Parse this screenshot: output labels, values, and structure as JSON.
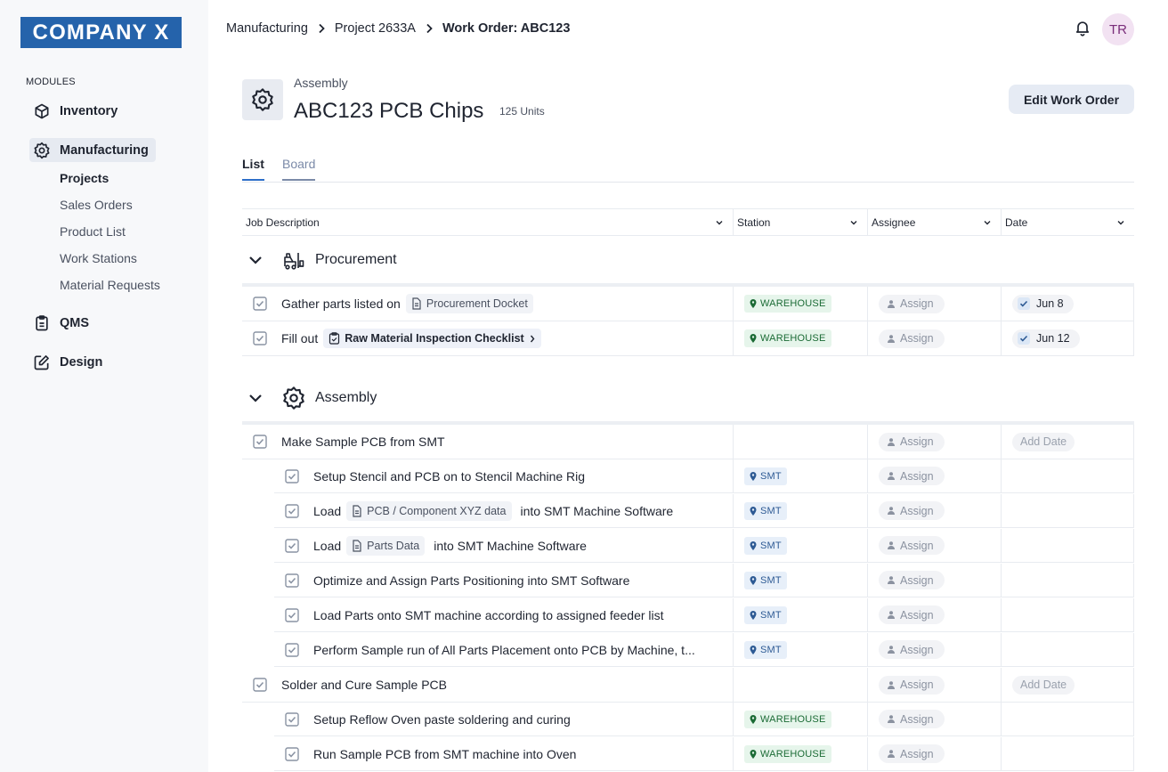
{
  "brand": {
    "logo_text": "COMPANY X",
    "accent": "#2563ab"
  },
  "sidebar": {
    "modules_label": "MODULES",
    "items": [
      {
        "label": "Inventory",
        "icon": "cube-icon"
      },
      {
        "label": "Manufacturing",
        "icon": "gear-icon",
        "active": true
      },
      {
        "label": "QMS",
        "icon": "clipboard-icon"
      },
      {
        "label": "Design",
        "icon": "edit-icon"
      }
    ],
    "sub_items": [
      {
        "label": "Projects",
        "active": true
      },
      {
        "label": "Sales Orders"
      },
      {
        "label": "Product List"
      },
      {
        "label": "Work Stations"
      },
      {
        "label": "Material Requests"
      }
    ]
  },
  "header": {
    "breadcrumb": [
      "Manufacturing",
      "Project 2633A",
      "Work Order: ABC123"
    ],
    "avatar_initials": "TR",
    "icons": [
      "bell-icon"
    ]
  },
  "work_order": {
    "category": "Assembly",
    "title": "ABC123 PCB Chips",
    "units": "125 Units",
    "edit_label": "Edit Work Order"
  },
  "tabs": [
    {
      "label": "List",
      "active": true
    },
    {
      "label": "Board",
      "active": false
    }
  ],
  "table": {
    "columns": [
      "Job Description",
      "Station",
      "Assignee",
      "Date"
    ],
    "assign_label": "Assign",
    "add_date_label": "Add Date",
    "groups": [
      {
        "name": "Procurement",
        "icon": "forklift-icon",
        "rows": [
          {
            "pre": "Gather parts listed on",
            "chip": "Procurement Docket",
            "station": "WAREHOUSE",
            "date": "Jun 8"
          },
          {
            "pre": "Fill out",
            "chip": "Raw Material Inspection Checklist",
            "station": "WAREHOUSE",
            "date": "Jun 12"
          }
        ]
      },
      {
        "name": "Assembly",
        "icon": "gear-icon",
        "rows": [
          {
            "text": "Make Sample PCB from SMT",
            "add_date": true
          },
          {
            "text": "Setup Stencil and PCB on to Stencil Machine Rig",
            "station": "SMT",
            "sub": true
          },
          {
            "pre": "Load",
            "chip": "PCB / Component XYZ data",
            "post": "into SMT Machine Software",
            "station": "SMT",
            "sub": true
          },
          {
            "pre": "Load",
            "chip": "Parts Data",
            "post": "into SMT Machine Software",
            "station": "SMT",
            "sub": true
          },
          {
            "text": "Optimize and Assign Parts Positioning into SMT Software",
            "station": "SMT",
            "sub": true
          },
          {
            "text": "Load Parts onto SMT machine according to assigned feeder list",
            "station": "SMT",
            "sub": true
          },
          {
            "text": "Perform Sample run of All Parts Placement onto PCB by Machine, t...",
            "station": "SMT",
            "sub": true
          },
          {
            "text": "Solder and Cure Sample PCB",
            "add_date": true
          },
          {
            "text": "Setup Reflow Oven paste soldering and curing",
            "station": "WAREHOUSE",
            "sub": true
          },
          {
            "text": "Run Sample PCB from SMT machine into Oven",
            "station": "WAREHOUSE",
            "sub": true
          }
        ]
      }
    ]
  }
}
